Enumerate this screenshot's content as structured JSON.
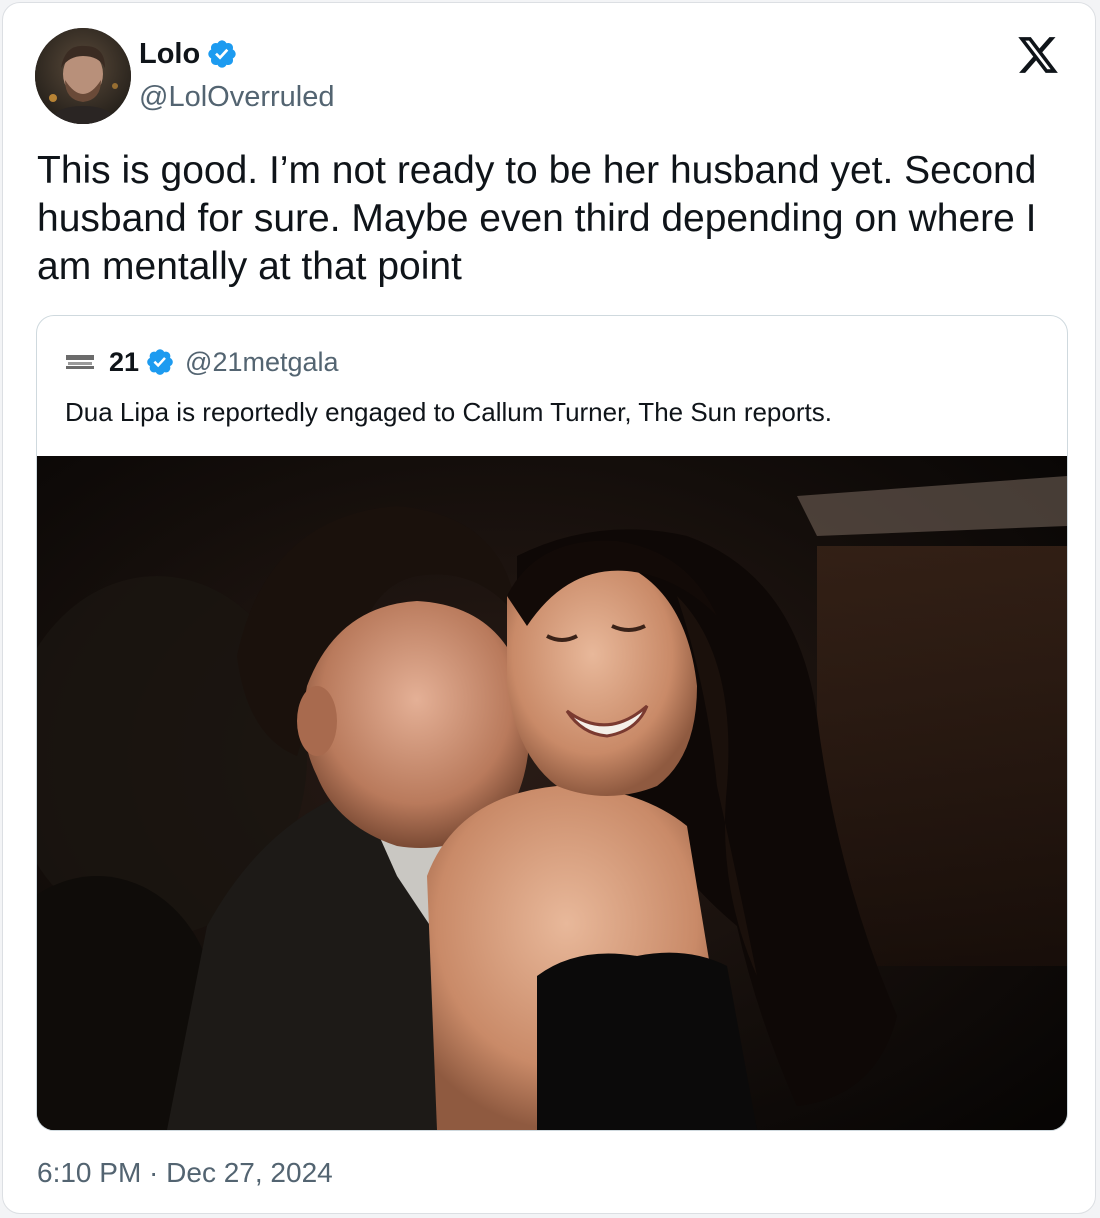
{
  "author": {
    "name": "Lolo",
    "handle": "@LolOverruled",
    "verified": true,
    "avatar": "profile-photo"
  },
  "tweet": {
    "text": "This is good. I’m not ready to be her husband yet. Second husband for sure. Maybe even third depending on where I am mentally at that point",
    "time": "6:10 PM",
    "date": "Dec 27, 2024",
    "timestamp": "6:10 PM · Dec 27, 2024"
  },
  "quoted_tweet": {
    "name": "21",
    "handle": "@21metgala",
    "verified": true,
    "avatar": "met-gala-logo",
    "text": "Dua Lipa is reportedly engaged to Callum Turner, The Sun reports.",
    "media": "photo-couple-at-night"
  },
  "brand": {
    "logo": "x-logo",
    "verified_color": "#1d9bf0",
    "text_primary": "#0f1419",
    "text_secondary": "#536471",
    "border": "#cfd9de"
  }
}
